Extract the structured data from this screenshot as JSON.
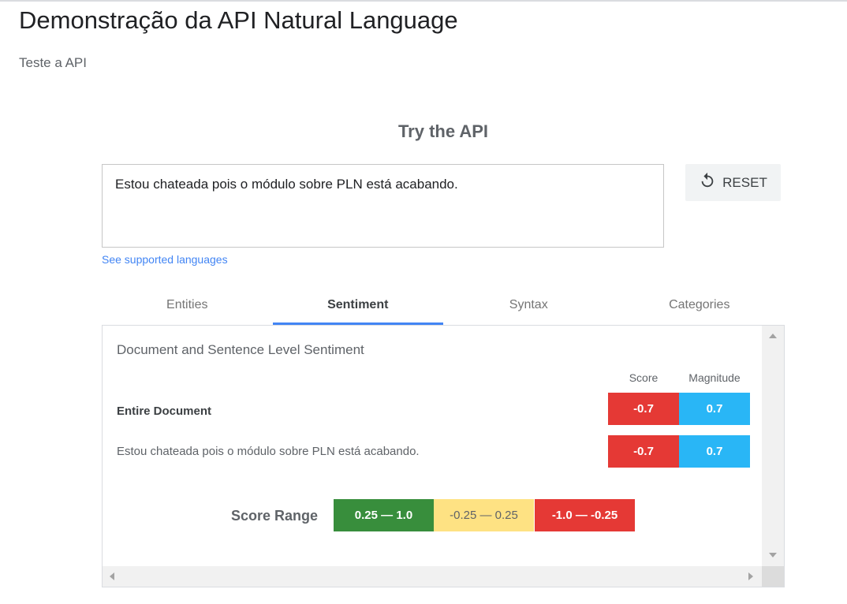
{
  "page": {
    "title": "Demonstração da API Natural Language",
    "subtitle": "Teste a API"
  },
  "demo": {
    "heading": "Try the API",
    "input_text": "Estou chateada pois o módulo sobre PLN está acabando.",
    "reset_label": "RESET",
    "reset_icon": "refresh-icon",
    "languages_link": "See supported languages"
  },
  "tabs": [
    {
      "label": "Entities",
      "active": false
    },
    {
      "label": "Sentiment",
      "active": true
    },
    {
      "label": "Syntax",
      "active": false
    },
    {
      "label": "Categories",
      "active": false
    }
  ],
  "sentiment": {
    "heading": "Document and Sentence Level Sentiment",
    "columns": {
      "score": "Score",
      "magnitude": "Magnitude"
    },
    "rows": [
      {
        "label": "Entire Document",
        "score": "-0.7",
        "magnitude": "0.7"
      },
      {
        "label": "Estou chateada pois o módulo sobre PLN está acabando.",
        "score": "-0.7",
        "magnitude": "0.7"
      }
    ],
    "score_range": {
      "label": "Score Range",
      "ranges": [
        {
          "text": "0.25 — 1.0",
          "color": "#388e3c"
        },
        {
          "text": "-0.25 — 0.25",
          "color": "#fee283"
        },
        {
          "text": "-1.0 — -0.25",
          "color": "#e53935"
        }
      ]
    }
  },
  "colors": {
    "negative": "#e53935",
    "magnitude": "#29b6f6",
    "accent": "#4285f4"
  }
}
